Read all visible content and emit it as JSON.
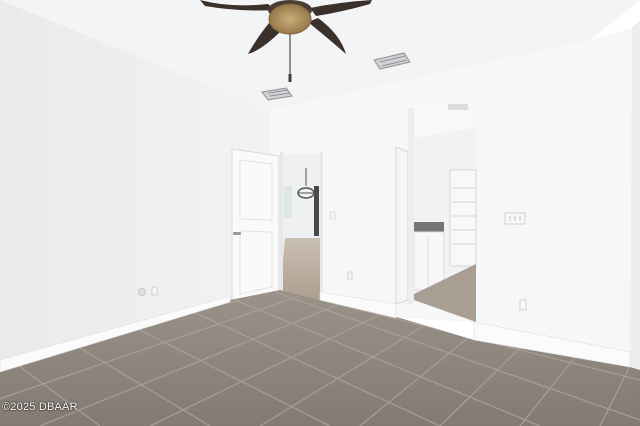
{
  "photo": {
    "watermark": "©2025 DBAAR",
    "palette": {
      "wall_left": "#f0f1f2",
      "wall_right": "#f6f7f8",
      "ceiling": "#f4f5f6",
      "floor": "#8e877f",
      "grout": "#a49d95",
      "door": "#fafafa",
      "fan_blade": "#3b302a",
      "fan_light": "#b09461"
    },
    "icons": [
      "ceiling-fan-icon",
      "air-vent-icon",
      "pendant-light-icon",
      "light-switch-icon",
      "power-outlet-icon"
    ]
  }
}
